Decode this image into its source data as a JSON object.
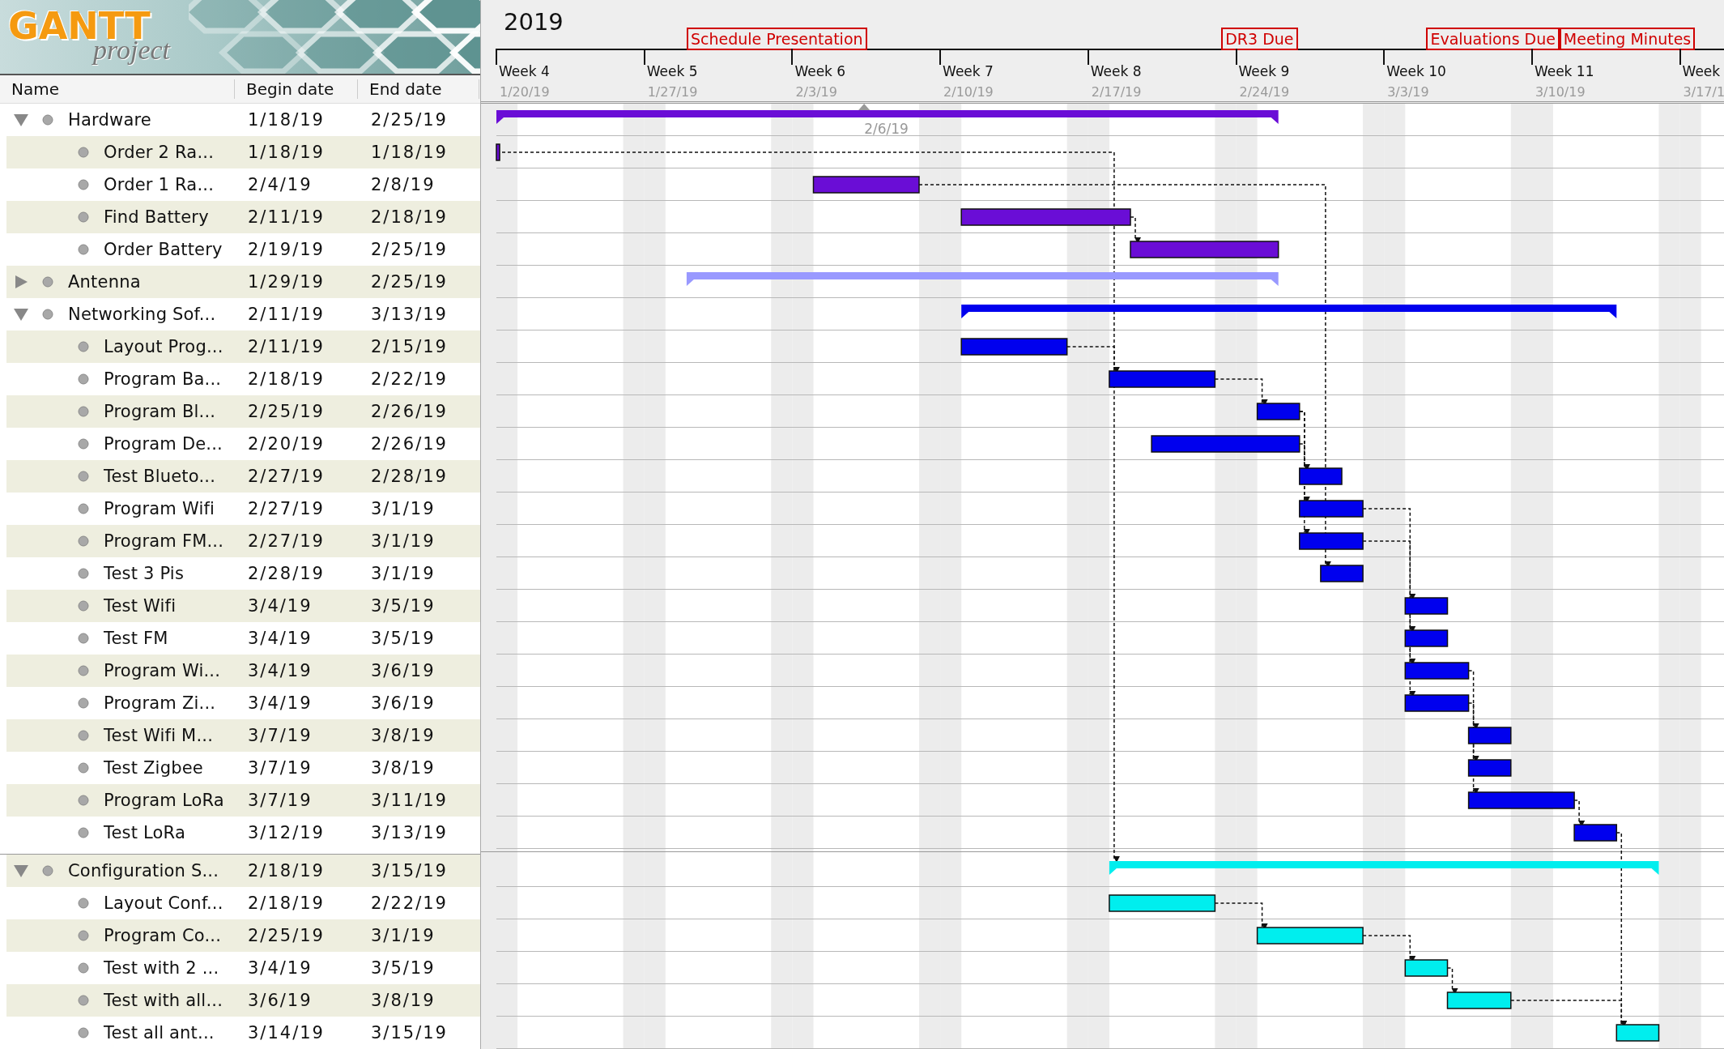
{
  "logo": {
    "title": "GANTT",
    "subtitle": "project"
  },
  "table": {
    "columns": [
      "Name",
      "Begin date",
      "End date"
    ],
    "sections": [
      {
        "groups": [
          {
            "name": "Hardware",
            "begin": "1/18/19",
            "end": "2/25/19",
            "expanded": true,
            "color": "#6a0dd6",
            "children": [
              {
                "name": "Order 2 Ra...",
                "begin": "1/18/19",
                "end": "1/18/19"
              },
              {
                "name": "Order 1 Ra...",
                "begin": "2/4/19",
                "end": "2/8/19"
              },
              {
                "name": "Find Battery",
                "begin": "2/11/19",
                "end": "2/18/19"
              },
              {
                "name": "Order Battery",
                "begin": "2/19/19",
                "end": "2/25/19"
              }
            ]
          },
          {
            "name": "Antenna",
            "begin": "1/29/19",
            "end": "2/25/19",
            "expanded": false,
            "color": "#9999ff"
          },
          {
            "name": "Networking Sof...",
            "begin": "2/11/19",
            "end": "3/13/19",
            "expanded": true,
            "color": "#0000ee",
            "children": [
              {
                "name": "Layout Prog...",
                "begin": "2/11/19",
                "end": "2/15/19"
              },
              {
                "name": "Program Ba...",
                "begin": "2/18/19",
                "end": "2/22/19"
              },
              {
                "name": "Program Bl...",
                "begin": "2/25/19",
                "end": "2/26/19"
              },
              {
                "name": "Program De...",
                "begin": "2/20/19",
                "end": "2/26/19"
              },
              {
                "name": "Test Blueto...",
                "begin": "2/27/19",
                "end": "2/28/19"
              },
              {
                "name": "Program Wifi",
                "begin": "2/27/19",
                "end": "3/1/19"
              },
              {
                "name": "Program FM...",
                "begin": "2/27/19",
                "end": "3/1/19"
              },
              {
                "name": "Test 3 Pis",
                "begin": "2/28/19",
                "end": "3/1/19"
              },
              {
                "name": "Test Wifi",
                "begin": "3/4/19",
                "end": "3/5/19"
              },
              {
                "name": "Test FM",
                "begin": "3/4/19",
                "end": "3/5/19"
              },
              {
                "name": "Program Wi...",
                "begin": "3/4/19",
                "end": "3/6/19"
              },
              {
                "name": "Program Zi...",
                "begin": "3/4/19",
                "end": "3/6/19"
              },
              {
                "name": "Test Wifi M...",
                "begin": "3/7/19",
                "end": "3/8/19"
              },
              {
                "name": "Test Zigbee",
                "begin": "3/7/19",
                "end": "3/8/19"
              },
              {
                "name": "Program LoRa",
                "begin": "3/7/19",
                "end": "3/11/19"
              },
              {
                "name": "Test LoRa",
                "begin": "3/12/19",
                "end": "3/13/19"
              }
            ]
          }
        ]
      },
      {
        "groups": [
          {
            "name": "Configuration S...",
            "begin": "2/18/19",
            "end": "3/15/19",
            "expanded": true,
            "color": "#00eeee",
            "children": [
              {
                "name": "Layout Conf...",
                "begin": "2/18/19",
                "end": "2/22/19"
              },
              {
                "name": "Program Co...",
                "begin": "2/25/19",
                "end": "3/1/19"
              },
              {
                "name": "Test with 2 ...",
                "begin": "3/4/19",
                "end": "3/5/19"
              },
              {
                "name": "Test with all...",
                "begin": "3/6/19",
                "end": "3/8/19"
              },
              {
                "name": "Test all ant...",
                "begin": "3/14/19",
                "end": "3/15/19"
              }
            ]
          }
        ]
      }
    ]
  },
  "timeline": {
    "year": "2019",
    "milestones": [
      "Schedule Presentation",
      "DR3 Due",
      "Evaluations Due",
      "Meeting Minutes"
    ],
    "weeks": [
      {
        "label": "Week 4",
        "date": "1/20/19"
      },
      {
        "label": "Week 5",
        "date": "1/27/19"
      },
      {
        "label": "Week 6",
        "date": "2/3/19"
      },
      {
        "label": "Week 7",
        "date": "2/10/19"
      },
      {
        "label": "Week 8",
        "date": "2/17/19"
      },
      {
        "label": "Week 9",
        "date": "2/24/19"
      },
      {
        "label": "Week 10",
        "date": "3/3/19"
      },
      {
        "label": "Week 11",
        "date": "3/10/19"
      },
      {
        "label": "Week",
        "date": "3/17/1"
      }
    ],
    "today": "2/6/19"
  }
}
